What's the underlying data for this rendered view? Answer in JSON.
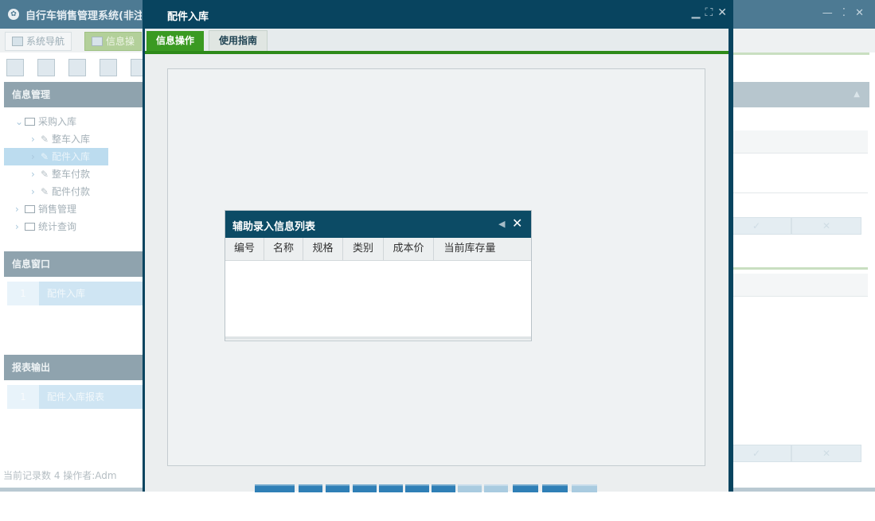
{
  "app": {
    "title": "自行车销售管理系统(非注",
    "controls": "— ⁚ ✕"
  },
  "bg_tabs": [
    {
      "label": "系统导航"
    },
    {
      "label": "信息操"
    }
  ],
  "sidebar": {
    "info_mgmt_title": "信息管理",
    "tree": [
      {
        "label": "采购入库"
      },
      {
        "label": "整车入库"
      },
      {
        "label": "配件入库"
      },
      {
        "label": "整车付款"
      },
      {
        "label": "配件付款"
      },
      {
        "label": "销售管理"
      },
      {
        "label": "统计查询"
      }
    ],
    "info_window_title": "信息窗口",
    "window_items": [
      {
        "num": "1",
        "label": "配件入库"
      }
    ],
    "report_title": "报表输出",
    "report_items": [
      {
        "num": "1",
        "label": "配件入库报表"
      }
    ]
  },
  "status": {
    "text": "当前记录数 4    操作者:Adm"
  },
  "right_panel": {
    "confirm_glyph": "✓",
    "cancel_glyph": "✕",
    "collapse_glyph": "▲"
  },
  "dialog": {
    "title": "配件入库",
    "tabs": {
      "ops": "信息操作",
      "guide": "使用指南"
    },
    "subwindow": {
      "title": "辅助录入信息列表",
      "columns": [
        "编号",
        "名称",
        "规格",
        "类别",
        "成本价",
        "当前库存量"
      ],
      "rows": []
    }
  },
  "colors": {
    "dialog_bg": "#08445f",
    "active_tab": "#3a9a22",
    "sidebar_head": "#8fa3ae"
  }
}
